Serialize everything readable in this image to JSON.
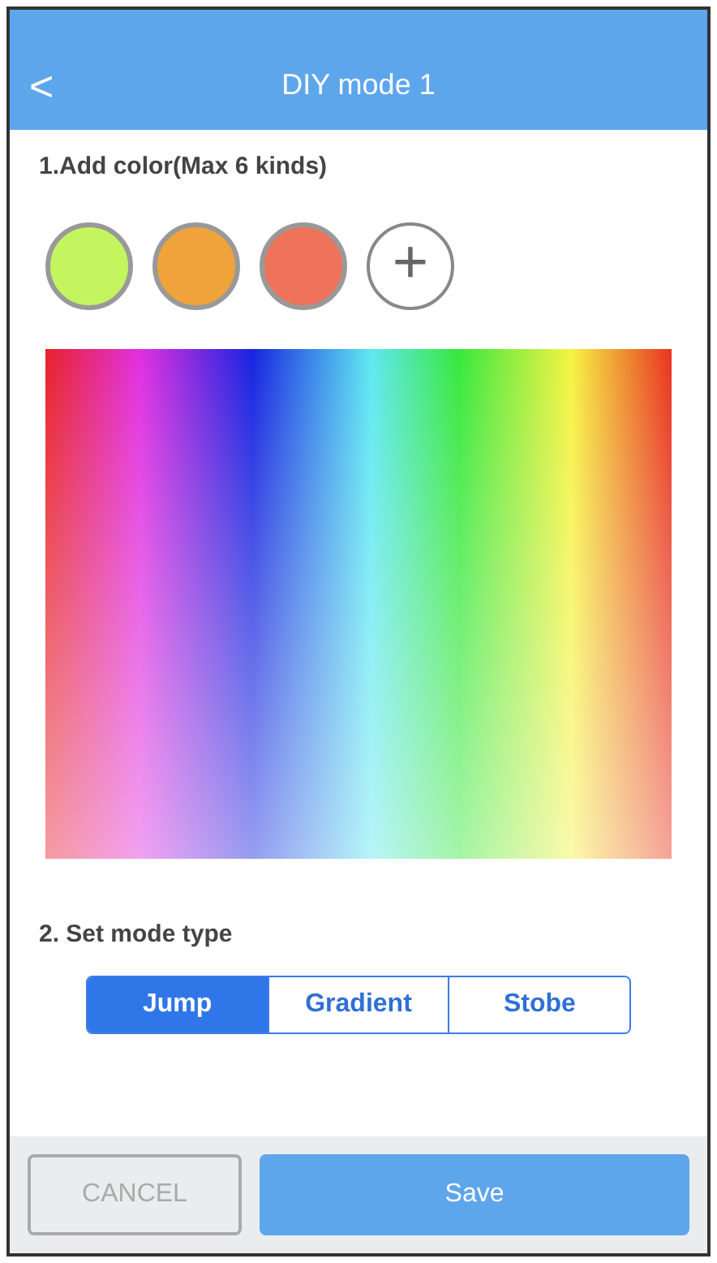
{
  "header": {
    "back": "<",
    "title": "DIY mode 1"
  },
  "colors_section": {
    "label": "1.Add color(Max 6 kinds)",
    "swatches": [
      {
        "color": "#c5f55e"
      },
      {
        "color": "#f0a33a"
      },
      {
        "color": "#ef735b"
      }
    ],
    "add_button": "+"
  },
  "mode_section": {
    "label": "2. Set mode type",
    "options": [
      {
        "label": "Jump",
        "selected": true
      },
      {
        "label": "Gradient",
        "selected": false
      },
      {
        "label": "Stobe",
        "selected": false
      }
    ]
  },
  "footer": {
    "buttons": [
      {
        "label": "CANCEL",
        "kind": "secondary",
        "disabled": true
      },
      {
        "label": "Save",
        "kind": "primary"
      }
    ]
  }
}
